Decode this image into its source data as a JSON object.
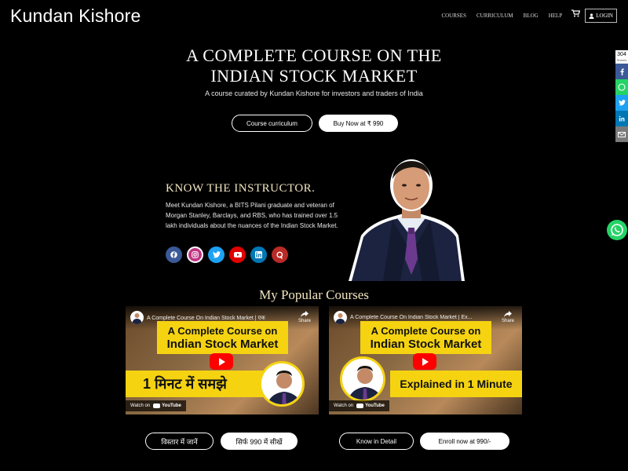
{
  "header": {
    "brand": "Kundan Kishore",
    "nav": [
      "COURSES",
      "CURRICULUM",
      "BLOG",
      "HELP"
    ],
    "login": "LOGIN"
  },
  "hero": {
    "title_line1": "A COMPLETE COURSE ON THE",
    "title_line2": "INDIAN STOCK MARKET",
    "subtitle": "A course curated by Kundan Kishore for investors and traders of India",
    "btn_curriculum": "Course curriculum",
    "btn_buy": "Buy Now at ₹ 990"
  },
  "instructor": {
    "heading": "KNOW THE INSTRUCTOR.",
    "bio": "Meet Kundan Kishore, a BITS Pilani graduate and veteran of Morgan Stanley, Barclays, and RBS, who has trained over 1.5 lakh individuals about the nuances of the Indian Stock Market.",
    "socials": [
      "facebook-icon",
      "instagram-icon",
      "twitter-icon",
      "youtube-icon",
      "linkedin-icon",
      "quora-icon"
    ]
  },
  "popular": {
    "heading": "My Popular Courses",
    "videos": [
      {
        "title": "A Complete Course On Indian Stock Market | एक",
        "share": "Share",
        "line1": "A Complete Course on",
        "line2": "Indian Stock Market",
        "banner": "1 मिनट में समझे",
        "watch_on": "Watch on",
        "yt": "YouTube"
      },
      {
        "title": "A Complete Course On Indian Stock Market | Ex...",
        "share": "Share",
        "line1": "A Complete Course on",
        "line2": "Indian Stock Market",
        "banner": "Explained in 1 Minute",
        "watch_on": "Watch on",
        "yt": "YouTube"
      }
    ],
    "buttons": {
      "hindi_detail": "विस्तार में जानें",
      "hindi_learn": "सिर्फ 990 में सीखें",
      "know_detail": "Know in Detail",
      "enroll": "Enroll now at 990/-"
    }
  },
  "share_bar": {
    "count": "304",
    "count_label": "Shares"
  },
  "colors": {
    "accent_gold": "#f2e6c0",
    "banner_yellow": "#f5d311",
    "facebook": "#3b5998",
    "whatsapp": "#25d366",
    "twitter": "#1da1f2",
    "linkedin": "#0077b5",
    "youtube": "#e00000"
  }
}
